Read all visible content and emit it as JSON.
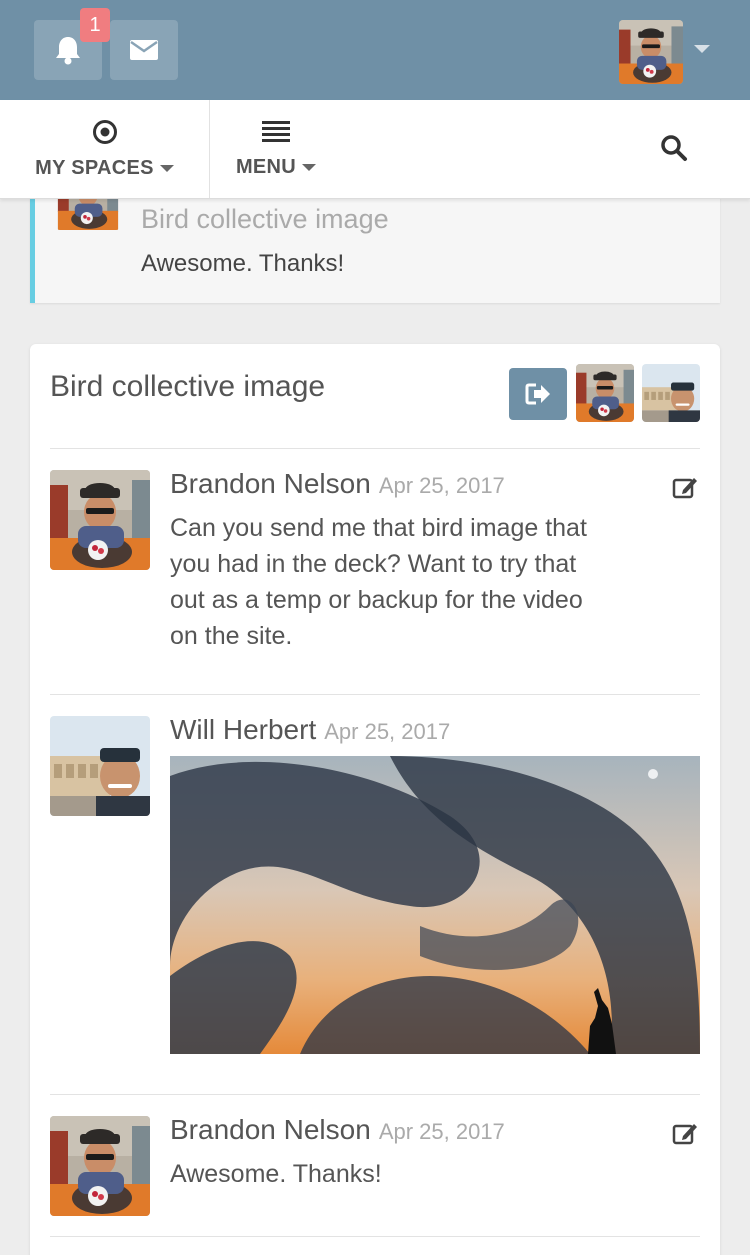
{
  "topbar": {
    "notifications_count": "1",
    "icons": [
      "bell-icon",
      "envelope-icon",
      "caret-down-icon"
    ],
    "color": "#6f90a6"
  },
  "nav": {
    "spaces_label": "MY SPACES",
    "menu_label": "MENU",
    "icons": [
      "target-icon",
      "list-icon",
      "search-icon"
    ]
  },
  "preview": {
    "title": "Bird collective image",
    "text": "Awesome. Thanks!",
    "accent": "#67cde2"
  },
  "thread": {
    "title": "Bird collective image",
    "messages": [
      {
        "author": "Brandon Nelson",
        "date": "Apr 25, 2017",
        "lines": [
          "Can you send me that bird image that",
          "you had in the deck? Want to try that",
          "out as a temp or backup for the video",
          "on the site."
        ]
      },
      {
        "author": "Will Herbert",
        "date": "Apr 25, 2017"
      },
      {
        "author": "Brandon Nelson",
        "date": "Apr 25, 2017",
        "text": "Awesome. Thanks!"
      }
    ]
  }
}
